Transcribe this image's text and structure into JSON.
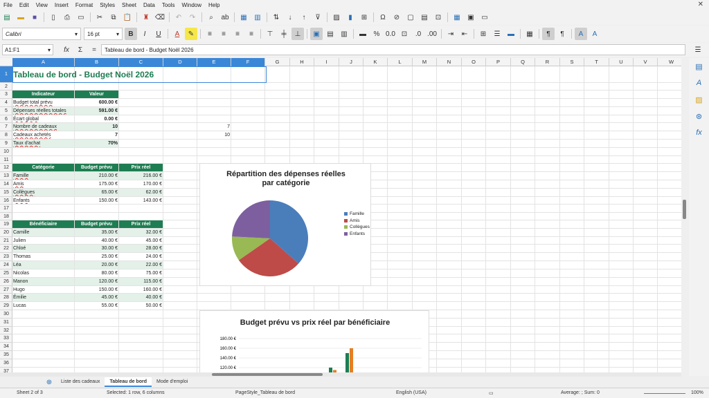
{
  "menu": [
    "File",
    "Edit",
    "View",
    "Insert",
    "Format",
    "Styles",
    "Sheet",
    "Data",
    "Tools",
    "Window",
    "Help"
  ],
  "toolbar": {
    "font_name": "Calibri",
    "font_size": "16 pt"
  },
  "formula": {
    "name_box": "A1:F1",
    "content": "Tableau de bord - Budget Noël 2026"
  },
  "columns": [
    "A",
    "B",
    "C",
    "D",
    "E",
    "F",
    "G",
    "H",
    "I",
    "J",
    "K",
    "L",
    "M",
    "N",
    "O",
    "P",
    "Q",
    "R",
    "S",
    "T",
    "U",
    "V",
    "W"
  ],
  "rows": [
    "1",
    "2",
    "3",
    "4",
    "5",
    "6",
    "7",
    "8",
    "9",
    "10",
    "11",
    "12",
    "13",
    "14",
    "15",
    "16",
    "17",
    "18",
    "19",
    "20",
    "21",
    "22",
    "23",
    "24",
    "25",
    "26",
    "27",
    "28",
    "29",
    "30",
    "31",
    "32",
    "33",
    "34",
    "35",
    "36",
    "37"
  ],
  "sheet": {
    "title": "Tableau de bord - Budget Noël 2026",
    "summary_headers": [
      "Indicateur",
      "Valeur"
    ],
    "summary": [
      {
        "label": "Budget total prévu",
        "value": "600.00 €"
      },
      {
        "label": "Dépenses réelles totales",
        "value": "591.00 €"
      },
      {
        "label": "Écart global",
        "value": "0.00 €"
      },
      {
        "label": "Nombre de cadeaux",
        "value": "10"
      },
      {
        "label": "Cadeaux achetés",
        "value": "7"
      },
      {
        "label": "Taux d'achat",
        "value": "70%"
      }
    ],
    "e7": "7",
    "e8": "10",
    "cat_headers": [
      "Catégorie",
      "Budget prévu",
      "Prix réel"
    ],
    "categories": [
      {
        "name": "Famille",
        "budget": "210.00 €",
        "reel": "216.00 €"
      },
      {
        "name": "Amis",
        "budget": "175.00 €",
        "reel": "170.00 €"
      },
      {
        "name": "Collègues",
        "budget": "65.00 €",
        "reel": "62.00 €"
      },
      {
        "name": "Enfants",
        "budget": "150.00 €",
        "reel": "143.00 €"
      }
    ],
    "ben_headers": [
      "Bénéficiaire",
      "Budget prévu",
      "Prix réel"
    ],
    "beneficiaries": [
      {
        "name": "Camille",
        "budget": "35.00 €",
        "reel": "32.00 €"
      },
      {
        "name": "Julien",
        "budget": "40.00 €",
        "reel": "45.00 €"
      },
      {
        "name": "Chloé",
        "budget": "30.00 €",
        "reel": "28.00 €"
      },
      {
        "name": "Thomas",
        "budget": "25.00 €",
        "reel": "24.00 €"
      },
      {
        "name": "Léa",
        "budget": "20.00 €",
        "reel": "22.00 €"
      },
      {
        "name": "Nicolas",
        "budget": "80.00 €",
        "reel": "75.00 €"
      },
      {
        "name": "Manon",
        "budget": "120.00 €",
        "reel": "115.00 €"
      },
      {
        "name": "Hugo",
        "budget": "150.00 €",
        "reel": "160.00 €"
      },
      {
        "name": "Émilie",
        "budget": "45.00 €",
        "reel": "40.00 €"
      },
      {
        "name": "Lucas",
        "budget": "55.00 €",
        "reel": "50.00 €"
      }
    ]
  },
  "chart_data": [
    {
      "type": "pie",
      "title": "Répartition des dépenses réelles par catégorie",
      "categories": [
        "Famille",
        "Amis",
        "Collègues",
        "Enfants"
      ],
      "values": [
        216,
        170,
        62,
        143
      ],
      "colors": [
        "#4a7ebb",
        "#be4b48",
        "#98b954",
        "#7d5fa0"
      ],
      "legend": "right"
    },
    {
      "type": "bar",
      "title": "Budget prévu vs prix réel par bénéficiaire",
      "yticks": [
        "180.00 €",
        "160.00 €",
        "140.00 €",
        "120.00 €"
      ],
      "ylim": [
        100,
        180
      ],
      "visible_values": [
        {
          "budget": 120,
          "reel": 115
        },
        {
          "budget": 150,
          "reel": 160
        }
      ],
      "colors": [
        "#1e7d52",
        "#e67e22"
      ]
    }
  ],
  "tabs": [
    "Liste des cadeaux",
    "Tableau de bord",
    "Mode d'emploi"
  ],
  "status": {
    "sheet": "Sheet 2 of 3",
    "selection": "Selected: 1 row, 6 columns",
    "page_style": "PageStyle_Tableau de bord",
    "language": "English (USA)",
    "sum": "Average: ; Sum: 0",
    "zoom": "100%"
  }
}
